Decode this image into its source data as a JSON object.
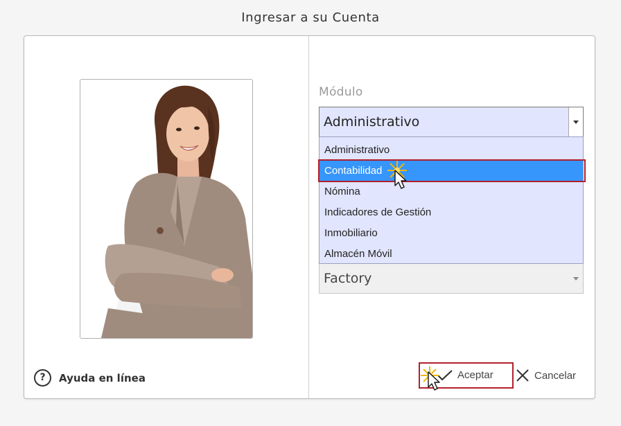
{
  "window": {
    "title": "Ingresar a su Cuenta"
  },
  "help": {
    "label": "Ayuda en línea"
  },
  "module": {
    "label": "Módulo",
    "selected": "Administrativo",
    "options": [
      "Administrativo",
      "Contabilidad",
      "Nómina",
      "Indicadores de Gestión",
      "Inmobiliario",
      "Almacén Móvil"
    ],
    "highlighted_option": "Contabilidad"
  },
  "company": {
    "selected": "Factory"
  },
  "buttons": {
    "accept": "Aceptar",
    "cancel": "Cancelar"
  },
  "colors": {
    "selection": "#3796fb",
    "highlight_border": "#b21f2d",
    "dropdown_bg": "#e1e5fd"
  }
}
